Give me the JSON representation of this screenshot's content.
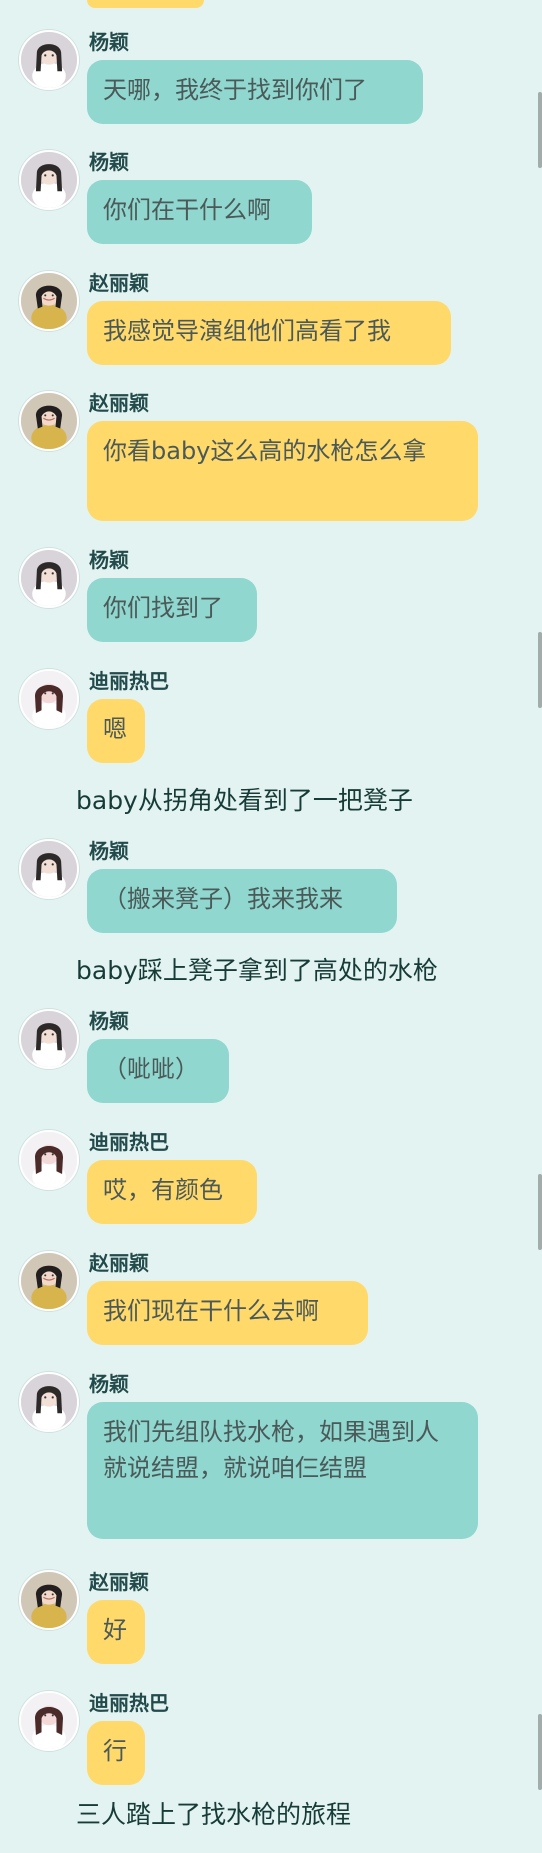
{
  "chat": {
    "messages": [
      {
        "speaker": "杨颖",
        "text": "天哪，我终于找到你们了",
        "color": "teal",
        "avatar": "yangying-avatar"
      },
      {
        "speaker": "杨颖",
        "text": "你们在干什么啊",
        "color": "teal",
        "avatar": "yangying-avatar"
      },
      {
        "speaker": "赵丽颖",
        "text": "我感觉导演组他们高看了我",
        "color": "yellow",
        "avatar": "zhaoliying-avatar"
      },
      {
        "speaker": "赵丽颖",
        "text": "你看baby这么高的水枪怎么拿",
        "color": "yellow",
        "avatar": "zhaoliying-avatar"
      },
      {
        "speaker": "杨颖",
        "text": "你们找到了",
        "color": "teal",
        "avatar": "yangying-avatar"
      },
      {
        "speaker": "迪丽热巴",
        "text": "嗯",
        "color": "yellow",
        "avatar": "dilireba-avatar"
      },
      {
        "speaker": "杨颖",
        "text": "（搬来凳子）我来我来",
        "color": "teal",
        "avatar": "yangying-avatar"
      },
      {
        "speaker": "杨颖",
        "text": "（呲呲）",
        "color": "teal",
        "avatar": "yangying-avatar"
      },
      {
        "speaker": "迪丽热巴",
        "text": "哎，有颜色",
        "color": "yellow",
        "avatar": "dilireba-avatar"
      },
      {
        "speaker": "赵丽颖",
        "text": "我们现在干什么去啊",
        "color": "yellow",
        "avatar": "zhaoliying-avatar"
      },
      {
        "speaker": "杨颖",
        "text": "我们先组队找水枪，如果遇到人就说结盟，就说咱仨结盟",
        "color": "teal",
        "avatar": "yangying-avatar"
      },
      {
        "speaker": "赵丽颖",
        "text": "好",
        "color": "yellow",
        "avatar": "zhaoliying-avatar"
      },
      {
        "speaker": "迪丽热巴",
        "text": "行",
        "color": "yellow",
        "avatar": "dilireba-avatar"
      }
    ],
    "narrations": [
      "baby从拐角处看到了一把凳子",
      "baby踩上凳子拿到了高处的水枪",
      "三人踏上了找水枪的旅程"
    ]
  },
  "colors": {
    "background": "#e3f3f2",
    "teal_bubble": "#8fd7cf",
    "yellow_bubble": "#ffd96a",
    "name_text": "#234b4b",
    "bubble_text": "#4b5958",
    "narration_text": "#173c38",
    "scrollbar": "#9ea8a7"
  }
}
